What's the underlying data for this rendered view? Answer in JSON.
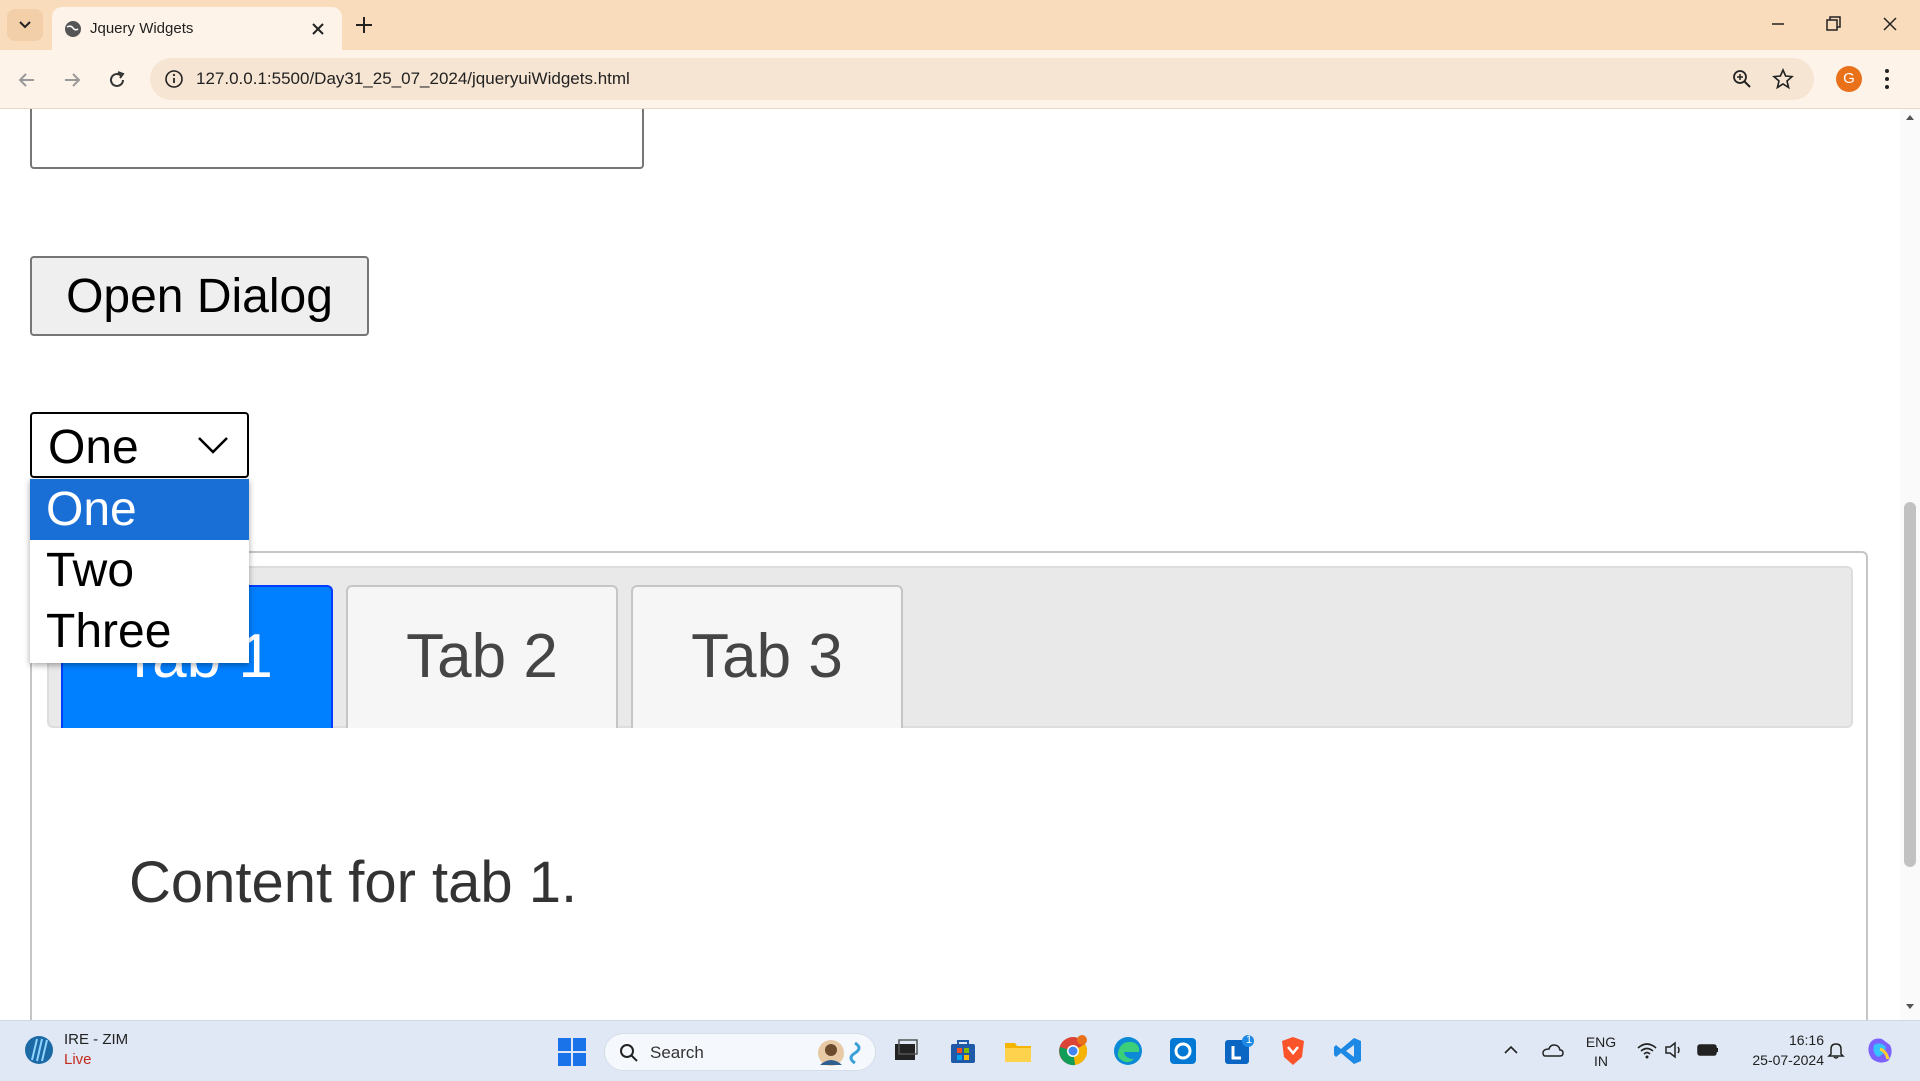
{
  "browser": {
    "tab_title": "Jquery Widgets",
    "url": "127.0.0.1:5500/Day31_25_07_2024/jqueryuiWidgets.html",
    "profile_initial": "G"
  },
  "page": {
    "open_dialog_label": "Open Dialog",
    "select": {
      "selected": "One",
      "options": [
        "One",
        "Two",
        "Three"
      ]
    },
    "tabs": [
      {
        "label": "Tab 1",
        "active": true
      },
      {
        "label": "Tab 2",
        "active": false
      },
      {
        "label": "Tab 3",
        "active": false
      }
    ],
    "tab_content": "Content for tab 1."
  },
  "taskbar": {
    "weather_line1": "IRE - ZIM",
    "weather_line2": "Live",
    "search_label": "Search",
    "lang_line1": "ENG",
    "lang_line2": "IN",
    "time": "16:16",
    "date": "25-07-2024",
    "badge_count": "1"
  },
  "colors": {
    "tab_active": "#007fff",
    "dropdown_selected": "#1a6fd6",
    "chrome_frame": "#f8dcbc"
  }
}
